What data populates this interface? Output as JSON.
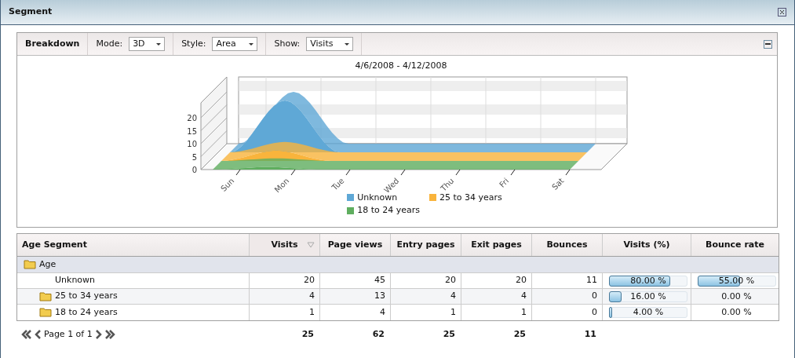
{
  "window": {
    "title": "Segment"
  },
  "breakdown": {
    "title": "Breakdown",
    "controls": [
      {
        "label": "Mode:",
        "value": "3D"
      },
      {
        "label": "Style:",
        "value": "Area"
      },
      {
        "label": "Show:",
        "value": "Visits"
      }
    ],
    "chart": {
      "title": "4/6/2008 - 4/12/2008",
      "y_ticks": [
        "20",
        "15",
        "10",
        "5",
        "0"
      ],
      "days": [
        "Sun",
        "Mon",
        "Tue",
        "Wed",
        "Thu",
        "Fri",
        "Sat"
      ],
      "legend": [
        {
          "name": "Unknown",
          "color": "#5fa8d6"
        },
        {
          "name": "25 to 34 years",
          "color": "#f9b43c"
        },
        {
          "name": "18 to 24 years",
          "color": "#5fae5f"
        }
      ]
    }
  },
  "table": {
    "columns": [
      {
        "label": "Age Segment",
        "sorted": false
      },
      {
        "label": "Visits",
        "sorted": true
      },
      {
        "label": "Page views",
        "sorted": false
      },
      {
        "label": "Entry pages",
        "sorted": false
      },
      {
        "label": "Exit pages",
        "sorted": false
      },
      {
        "label": "Bounces",
        "sorted": false
      },
      {
        "label": "Visits (%)",
        "sorted": false
      },
      {
        "label": "Bounce rate",
        "sorted": false
      }
    ],
    "rows": [
      {
        "kind": "group",
        "name": "Age"
      },
      {
        "kind": "leaf",
        "name": "Unknown",
        "cells": [
          "20",
          "45",
          "20",
          "20",
          "11"
        ],
        "visits_pct": {
          "text": "80.00 %",
          "level": 0.8
        },
        "bounce_rate": {
          "text": "55.00 %",
          "level": 0.55
        }
      },
      {
        "kind": "folder",
        "name": "25 to 34 years",
        "cells": [
          "4",
          "13",
          "4",
          "4",
          "0"
        ],
        "visits_pct": {
          "text": "16.00 %",
          "level": 0.16
        },
        "bounce_rate": {
          "text": "0.00 %"
        }
      },
      {
        "kind": "folder",
        "name": "18 to 24 years",
        "cells": [
          "1",
          "4",
          "1",
          "1",
          "0"
        ],
        "visits_pct": {
          "text": "4.00 %",
          "level": 0.04
        },
        "bounce_rate": {
          "text": "0.00 %"
        }
      }
    ],
    "pager": "Page 1 of 1",
    "totals": [
      "25",
      "62",
      "25",
      "25",
      "11"
    ]
  }
}
